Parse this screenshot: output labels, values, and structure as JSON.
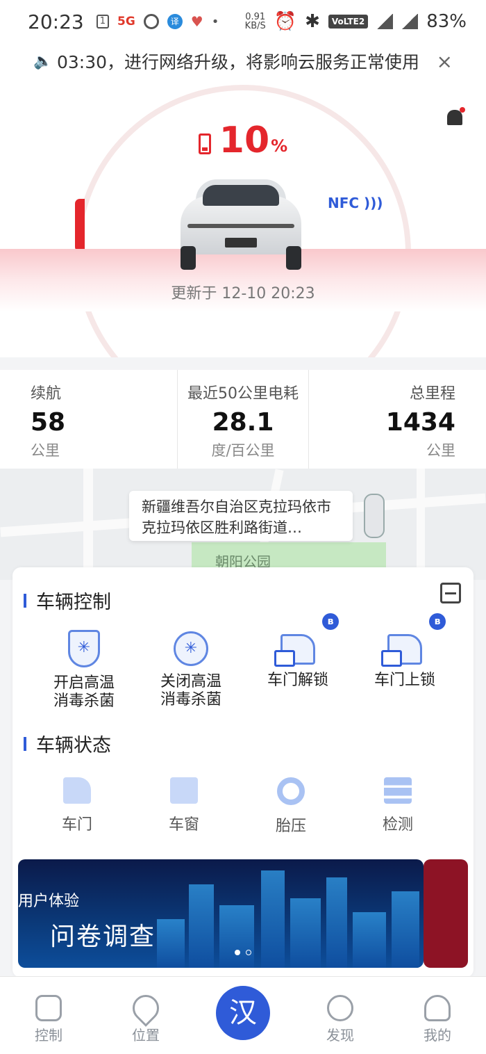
{
  "status_bar": {
    "time": "20:23",
    "net_5g": "5G",
    "speed_val": "0.91",
    "speed_unit": "KB/S",
    "volte": "VoLTE2",
    "battery": "83%"
  },
  "notice": {
    "text": "03:30，进行网络升级，将影响云服务正常使用",
    "close": "×"
  },
  "hero": {
    "battery_value": "10",
    "battery_unit": "%",
    "nfc": "NFC",
    "updated": "更新于 12-10 20:23"
  },
  "stats": [
    {
      "label": "续航",
      "value": "58",
      "unit": "公里"
    },
    {
      "label": "最近50公里电耗",
      "value": "28.1",
      "unit": "度/百公里"
    },
    {
      "label": "总里程",
      "value": "1434",
      "unit": "公里"
    }
  ],
  "map": {
    "address": "新疆维吾尔自治区克拉玛依市克拉玛依区胜利路街道…",
    "park": "朝阳公园"
  },
  "vehicle_control": {
    "title": "车辆控制",
    "items": [
      {
        "label": "开启高温消毒杀菌"
      },
      {
        "label": "关闭高温消毒杀菌"
      },
      {
        "label": "车门解锁"
      },
      {
        "label": "车门上锁"
      }
    ]
  },
  "vehicle_status": {
    "title": "车辆状态",
    "items": [
      {
        "label": "车门"
      },
      {
        "label": "车窗"
      },
      {
        "label": "胎压"
      },
      {
        "label": "检测"
      }
    ]
  },
  "banner": {
    "line1": "用户体验",
    "line2": "问卷调查"
  },
  "tabbar": {
    "items": [
      {
        "label": "控制"
      },
      {
        "label": "位置"
      },
      {
        "label": "发现"
      },
      {
        "label": "我的"
      }
    ],
    "center": "汉"
  },
  "colors": {
    "accent": "#2f5bd8",
    "battery_red": "#e4262c"
  }
}
